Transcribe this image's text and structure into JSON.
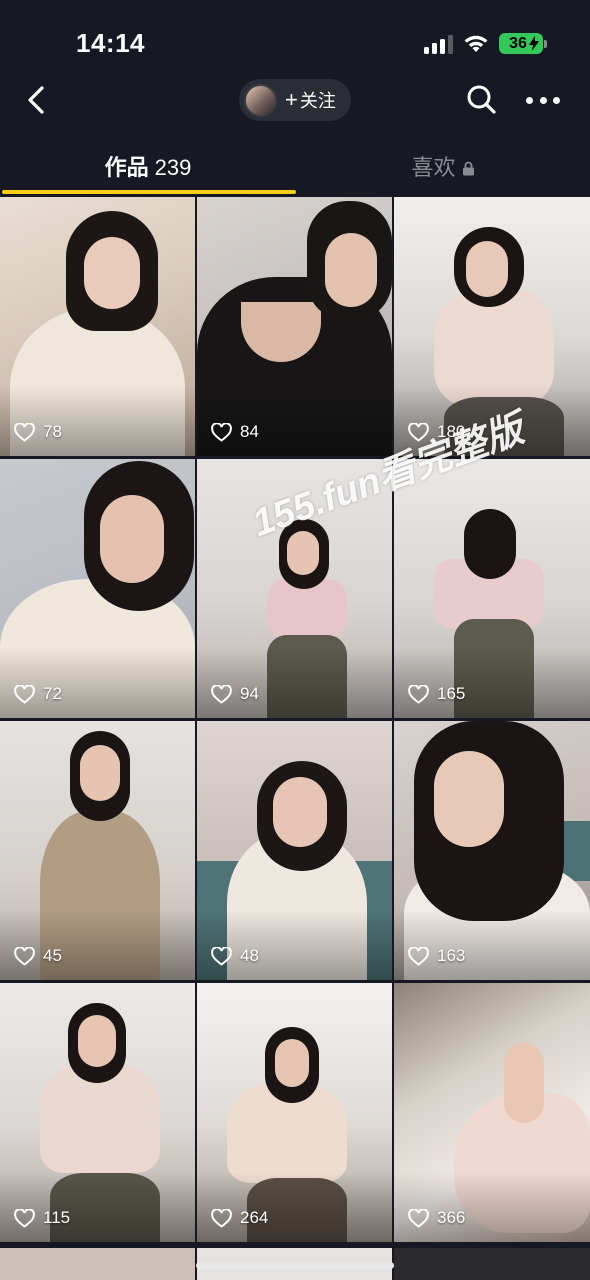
{
  "status_bar": {
    "time": "14:14",
    "battery": "36"
  },
  "nav": {
    "back_icon": "chevron-left-icon",
    "follow_plus": "+",
    "follow_label": "关注",
    "search_icon": "search-icon",
    "more_icon": "more-dots-icon"
  },
  "tabs": {
    "works_label": "作品",
    "works_count": "239",
    "likes_label": "喜欢",
    "likes_lock_icon": "lock-icon",
    "active_color": "#face15"
  },
  "watermark": "155.fun看完整版",
  "videos": [
    {
      "likes": "78"
    },
    {
      "likes": "84"
    },
    {
      "likes": "180"
    },
    {
      "likes": "72"
    },
    {
      "likes": "94"
    },
    {
      "likes": "165"
    },
    {
      "likes": "45"
    },
    {
      "likes": "48"
    },
    {
      "likes": "163"
    },
    {
      "likes": "115"
    },
    {
      "likes": "264"
    },
    {
      "likes": "366"
    }
  ]
}
